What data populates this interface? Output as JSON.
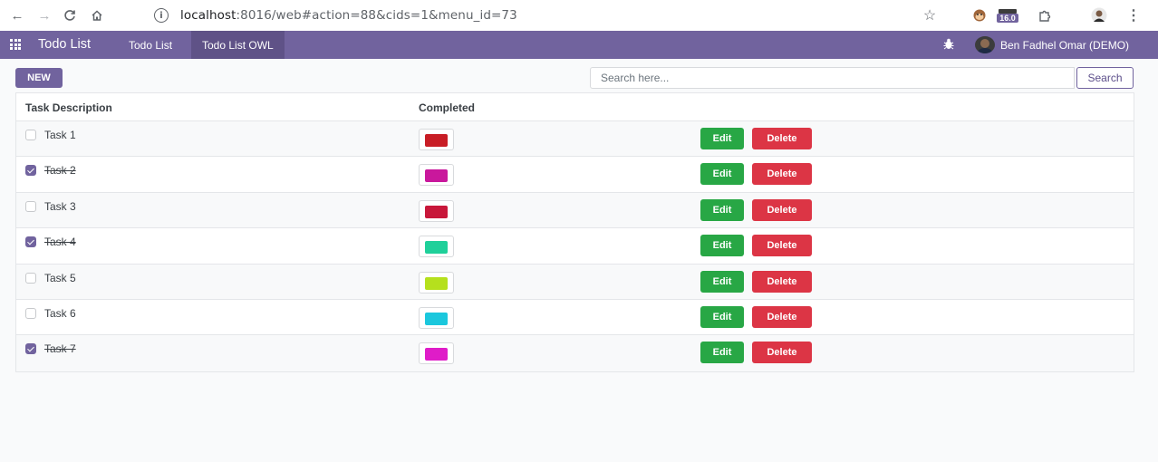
{
  "browser": {
    "url_host": "localhost",
    "url_rest": ":8016/web#action=88&cids=1&menu_id=73",
    "extension_badge": "16.0"
  },
  "navbar": {
    "brand": "Todo List",
    "items": [
      {
        "label": "Todo List",
        "active": false
      },
      {
        "label": "Todo List OWL",
        "active": true
      }
    ],
    "user_name": "Ben Fadhel Omar (DEMO)"
  },
  "toolbar": {
    "new_label": "NEW",
    "search_placeholder": "Search here...",
    "search_label": "Search"
  },
  "table": {
    "headers": [
      "Task Description",
      "Completed"
    ],
    "edit_label": "Edit",
    "delete_label": "Delete",
    "rows": [
      {
        "name": "Task 1",
        "completed": false,
        "color": "#c81d25"
      },
      {
        "name": "Task 2",
        "completed": true,
        "color": "#c9189c"
      },
      {
        "name": "Task 3",
        "completed": false,
        "color": "#c8173a"
      },
      {
        "name": "Task 4",
        "completed": true,
        "color": "#1fd09a"
      },
      {
        "name": "Task 5",
        "completed": false,
        "color": "#b5e01d"
      },
      {
        "name": "Task 6",
        "completed": false,
        "color": "#1bc7dd"
      },
      {
        "name": "Task 7",
        "completed": true,
        "color": "#df1cc8"
      }
    ]
  }
}
